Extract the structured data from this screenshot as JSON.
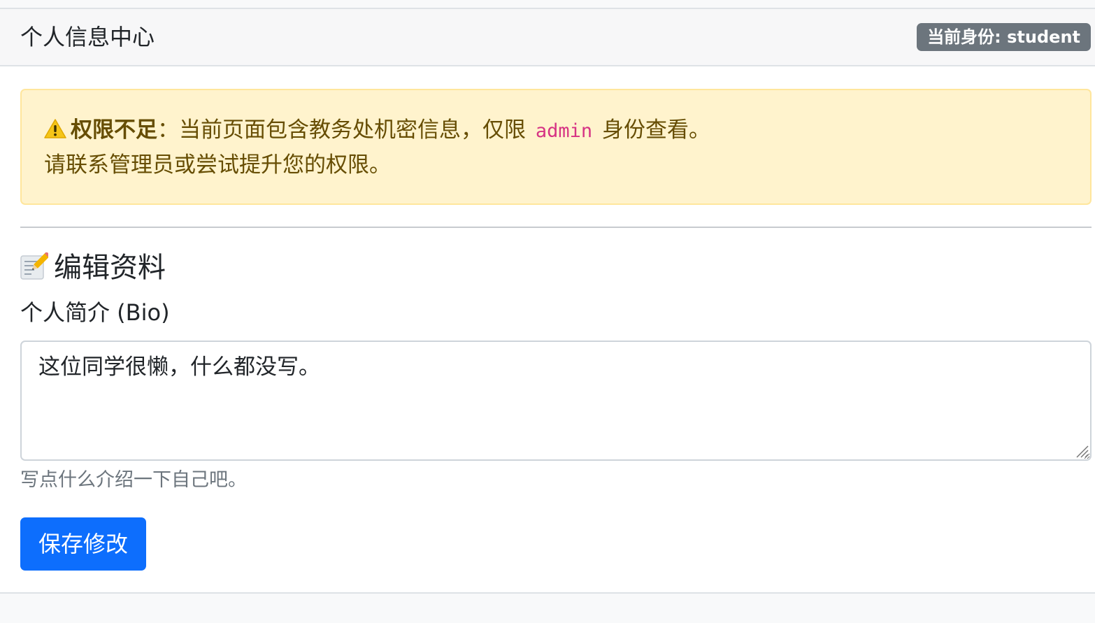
{
  "header": {
    "title": "个人信息中心",
    "role_badge": "当前身份: student"
  },
  "alert": {
    "icon": "warning-icon",
    "strong": "权限不足",
    "text_before_code": "：当前页面包含教务处机密信息，仅限",
    "code": "admin",
    "text_after_code": "身份查看。",
    "line2": "请联系管理员或尝试提升您的权限。",
    "color_bg": "#fff3cd",
    "color_text": "#664d03"
  },
  "edit": {
    "icon": "memo-icon",
    "title": "编辑资料",
    "bio_label": "个人简介 (Bio)",
    "bio_value": "这位同学很懒，什么都没写。",
    "bio_help": "写点什么介绍一下自己吧。",
    "save_label": "保存修改",
    "accent_color": "#0d6efd"
  }
}
